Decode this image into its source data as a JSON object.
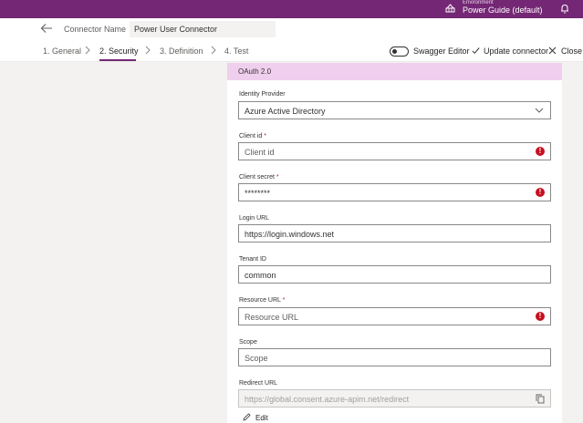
{
  "topbar": {
    "env_label": "Environment",
    "env_name": "Power Guide (default)",
    "env_icon": "environment-icon",
    "bell_icon": "bell-icon",
    "color": "#742774"
  },
  "name_row": {
    "label": "Connector Name",
    "value": "Power User Connector"
  },
  "steps": [
    {
      "label": "1. General",
      "active": false
    },
    {
      "label": "2. Security",
      "active": true
    },
    {
      "label": "3. Definition",
      "active": false
    },
    {
      "label": "4. Test",
      "active": false
    }
  ],
  "toolbar": {
    "swagger_label": "Swagger Editor",
    "swagger_on": false,
    "update_label": "Update connector",
    "close_label": "Close"
  },
  "oauth": {
    "title": "OAuth 2.0",
    "header_color": "#f0cfee"
  },
  "form": {
    "identity_provider": {
      "label": "Identity Provider",
      "value": "Azure Active Directory"
    },
    "client_id": {
      "label": "Client id",
      "required": "*",
      "placeholder": "Client id"
    },
    "client_secret": {
      "label": "Client secret",
      "required": "*",
      "value": "********"
    },
    "login_url": {
      "label": "Login URL",
      "value": "https://login.windows.net"
    },
    "tenant_id": {
      "label": "Tenant ID",
      "value": "common"
    },
    "resource_url": {
      "label": "Resource URL",
      "required": "*",
      "placeholder": "Resource URL"
    },
    "scope": {
      "label": "Scope",
      "placeholder": "Scope"
    },
    "redirect_url": {
      "label": "Redirect URL",
      "value": "https://global.consent.azure-apim.net/redirect"
    },
    "edit_label": "Edit"
  },
  "error_color": "#c50f1f"
}
